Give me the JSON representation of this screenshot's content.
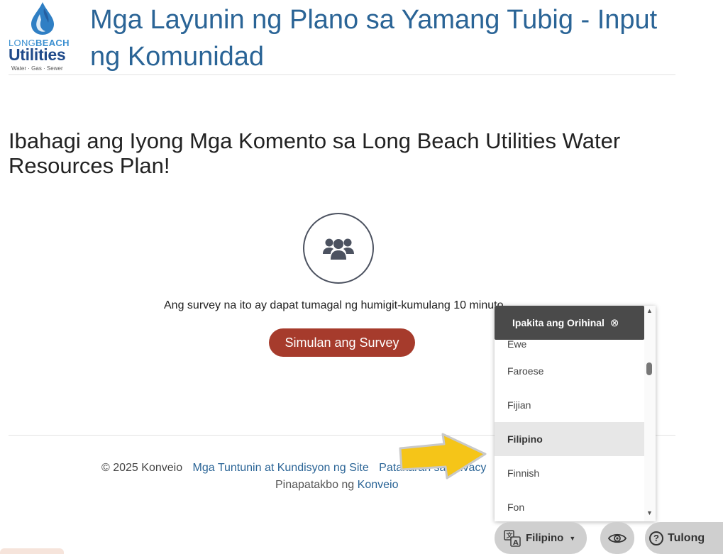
{
  "header": {
    "logo": {
      "brand_top_light": "LONG",
      "brand_top_bold": "BEACH",
      "brand_main": "Utilities",
      "brand_sub": "Water · Gas · Sewer"
    },
    "title": "Mga Layunin ng Plano sa Yamang Tubig - Input ng Komunidad"
  },
  "main": {
    "headline": "Ibahagi ang Iyong Mga Komento sa Long Beach Utilities Water Resources Plan!",
    "icon": "users-group-icon",
    "survey_time": "Ang survey na ito ay dapat tumagal ng humigit-kumulang 10 minuto.",
    "start_button": "Simulan ang Survey"
  },
  "footer": {
    "copyright": "© 2025 Konveio",
    "terms_link": "Mga Tuntunin at Kundisyon ng Site",
    "privacy_link": "Patakaran sa Privacy",
    "powered_by_label": "Pinapatakbo ng",
    "powered_by_link": "Konveio"
  },
  "language_dropdown": {
    "show_original": "Ipakita ang Orihinal",
    "items": [
      {
        "label": "Ewe",
        "selected": false
      },
      {
        "label": "Faroese",
        "selected": false
      },
      {
        "label": "Fijian",
        "selected": false
      },
      {
        "label": "Filipino",
        "selected": true
      },
      {
        "label": "Finnish",
        "selected": false
      },
      {
        "label": "Fon",
        "selected": false
      }
    ]
  },
  "toolbar": {
    "language_button": "Filipino",
    "language_icon": "translate-icon",
    "visibility_icon": "eye-icon",
    "help_button": "Tulong"
  },
  "colors": {
    "title": "#2a6496",
    "button": "#a63b2c",
    "arrow": "#f5c518",
    "toolbar_bg": "#cfcfcf",
    "dropdown_header": "#4a4a4a"
  }
}
